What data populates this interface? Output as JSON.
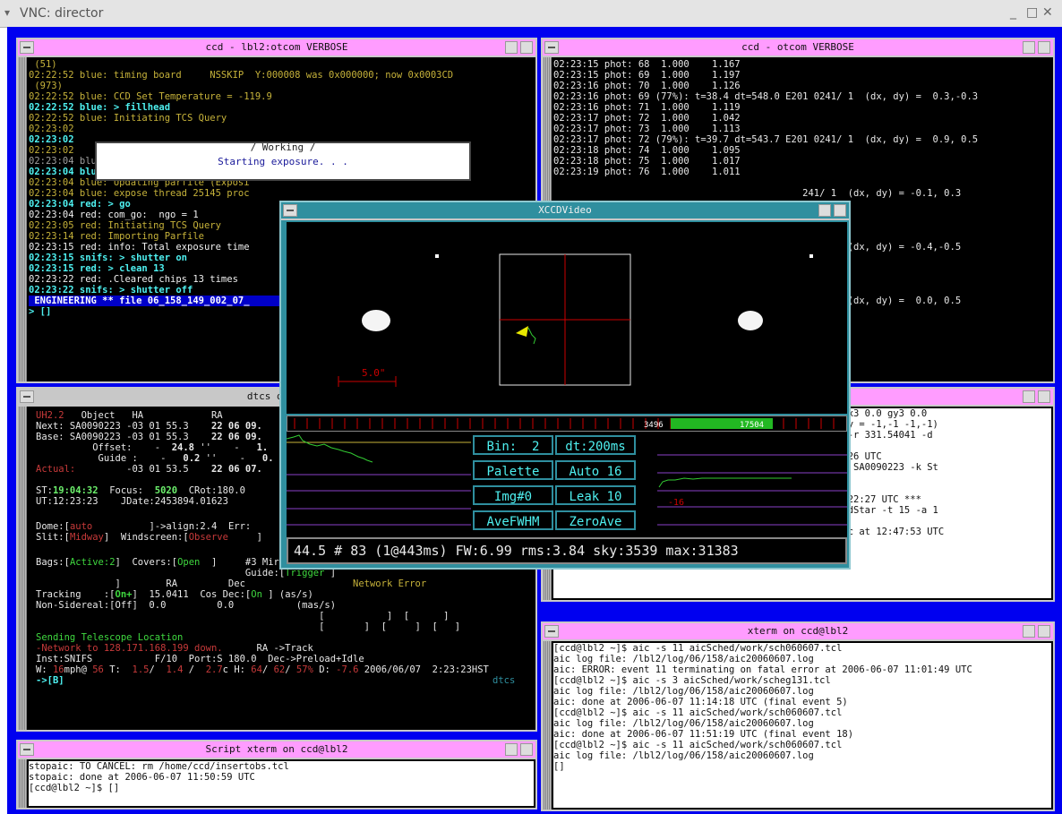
{
  "vnc": {
    "title": "VNC: director",
    "menu_glyph": "▾",
    "controls": [
      "_",
      "□",
      "✕"
    ]
  },
  "ccd_left": {
    "title": "ccd  -  lbl2:otcom VERBOSE",
    "lines": [
      {
        "t": " (51)",
        "c": "c-yel"
      },
      {
        "t": "02:22:52 blue: timing board     NSSKIP  Y:000008 was 0x000000; now 0x0003CD",
        "c": "c-yel"
      },
      {
        "t": " (973)",
        "c": "c-yel"
      },
      {
        "t": "02:22:52 blue: CCD Set Temperature = -119.9",
        "c": "c-yel"
      },
      {
        "t": "02:22:52 blue: > fillhead",
        "c": "c-cyan"
      },
      {
        "t": "02:22:52 blue: Initiating TCS Query",
        "c": "c-yel"
      },
      {
        "t": "02:23:02",
        "c": "c-yel"
      },
      {
        "t": "02:23:02",
        "c": "c-cyan"
      },
      {
        "t": "02:23:02",
        "c": "c-yel"
      },
      {
        "t": "02:23:04 blue: Updating parfile (Cleaned)",
        "c": "c-gray"
      },
      {
        "t": "02:23:04 blue: > expose auto",
        "c": "c-cyan"
      },
      {
        "t": "02:23:04 blue: Updating parfile (Exposi",
        "c": "c-yel"
      },
      {
        "t": "02:23:04 blue: expose thread 25145 proc",
        "c": "c-yel"
      },
      {
        "t": "02:23:04 red: > go",
        "c": "c-cyan"
      },
      {
        "t": "02:23:04 red: com_go:  ngo = 1",
        "c": "c-white"
      },
      {
        "t": "02:23:05 red: Initiating TCS Query",
        "c": "c-yel"
      },
      {
        "t": "02:23:14 red: Importing Parfile",
        "c": "c-yel"
      },
      {
        "t": "02:23:15 red: info: Total exposure time",
        "c": "c-white"
      },
      {
        "t": "02:23:15 snifs: > shutter on",
        "c": "c-cyan"
      },
      {
        "t": "02:23:15 red: > clean 13",
        "c": "c-cyan"
      },
      {
        "t": "02:23:22 red: .Cleared chips 13 times",
        "c": "c-white"
      },
      {
        "t": "02:23:22 snifs: > shutter off",
        "c": "c-cyan"
      },
      {
        "t": " ENGINEERING ** file 06_158_149_002_07_",
        "c": "hl"
      },
      {
        "t": "> []",
        "c": "c-cyan"
      }
    ],
    "working_header": "/ Working /",
    "working_message": "Starting exposure. . ."
  },
  "ccd_right": {
    "title": "ccd  -  otcom VERBOSE",
    "lines": [
      {
        "t": "02:23:15 phot: 68  1.000    1.167"
      },
      {
        "t": "02:23:15 phot: 69  1.000    1.197"
      },
      {
        "t": "02:23:16 phot: 70  1.000    1.126"
      },
      {
        "t": "02:23:16 phot: 69 (77%): t=38.4 dt=548.0 E201 0241/ 1  (dx, dy) =  0.3,-0.3"
      },
      {
        "t": "02:23:16 phot: 71  1.000    1.119"
      },
      {
        "t": "02:23:17 phot: 72  1.000    1.042"
      },
      {
        "t": "02:23:17 phot: 73  1.000    1.113"
      },
      {
        "t": "02:23:17 phot: 72 (79%): t=39.7 dt=543.7 E201 0241/ 1  (dx, dy) =  0.9, 0.5"
      },
      {
        "t": "02:23:18 phot: 74  1.000    1.095"
      },
      {
        "t": "02:23:18 phot: 75  1.000    1.017"
      },
      {
        "t": "02:23:19 phot: 76  1.000    1.011"
      },
      {
        "t": ""
      },
      {
        "t": "                                            241/ 1  (dx, dy) = -0.1, 0.3"
      },
      {
        "t": ""
      },
      {
        "t": ""
      },
      {
        "t": ""
      },
      {
        "t": ""
      },
      {
        "t": "                                            241/ 1  (dx, dy) = -0.4,-0.5"
      },
      {
        "t": ""
      },
      {
        "t": ""
      },
      {
        "t": ""
      },
      {
        "t": ""
      },
      {
        "t": "                                            241/ 1  (dx, dy) =  0.0, 0.5"
      }
    ]
  },
  "dtcs": {
    "title": "dtcs on cc",
    "footer_tag": "dtcs"
  },
  "mid_right": {
    "lines": [
      "                                    89.0 gy2 189.0 gx3 0.0 gy3 0.0",
      "                                    2x2 (CCD geometry = -1,-1 -1,-1)",
      "                                    0223 -k StdStar -r 331.54041 -d",
      "",
      "                                    006-06-07 12:22:26 UTC",
      "                                     point_object -o SA0090223 -k St",
      "",
      "",
      "                                    ) 2006-06-07 12:22:27 UTC ***",
      "                                     SA0090223 -d StdStar -t 15 -a 1",
      "",
      "12:22:28 parent: child pid 13855  timeout in 1525 sec at 12:47:53 UTC",
      "[]"
    ]
  },
  "xterm_ccd": {
    "title": "xterm on ccd@lbl2",
    "lines": [
      "[ccd@lbl2 ~]$ aic -s 11 aicSched/work/sch060607.tcl",
      "aic log file: /lbl2/log/06/158/aic20060607.log",
      "aic: ERROR: event 11 terminating on fatal error at 2006-06-07 11:01:49 UTC",
      "[ccd@lbl2 ~]$ aic -s 3 aicSched/work/scheg131.tcl",
      "aic log file: /lbl2/log/06/158/aic20060607.log",
      "aic: done at 2006-06-07 11:14:18 UTC (final event 5)",
      "[ccd@lbl2 ~]$ aic -s 11 aicSched/work/sch060607.tcl",
      "aic log file: /lbl2/log/06/158/aic20060607.log",
      "aic: done at 2006-06-07 11:51:19 UTC (final event 18)",
      "[ccd@lbl2 ~]$ aic -s 11 aicSched/work/sch060607.tcl",
      "aic log file: /lbl2/log/06/158/aic20060607.log",
      "[]"
    ]
  },
  "script_xterm": {
    "title": "Script xterm on ccd@lbl2",
    "lines": [
      "stopaic: TO CANCEL: rm /home/ccd/insertobs.tcl",
      "stopaic: done at 2006-06-07 11:50:59 UTC",
      "[ccd@lbl2 ~]$ []"
    ]
  },
  "xccd": {
    "title": "XCCDVideo",
    "scale_label": "5.0\"",
    "hist_low": "3496",
    "hist_high": "17504",
    "buttons": {
      "bin": "Bin:  2",
      "dt": "dt:200ms",
      "palette": "Palette",
      "auto": "Auto 16",
      "img": "Img#0",
      "leak": "Leak 10",
      "avefwhm": "AveFWHM",
      "zeroave": "ZeroAve"
    },
    "graph_label": "-16",
    "status": "44.5 # 83 (1@443ms) FW:6.99 rms:3.84 sky:3539 max:31383"
  }
}
